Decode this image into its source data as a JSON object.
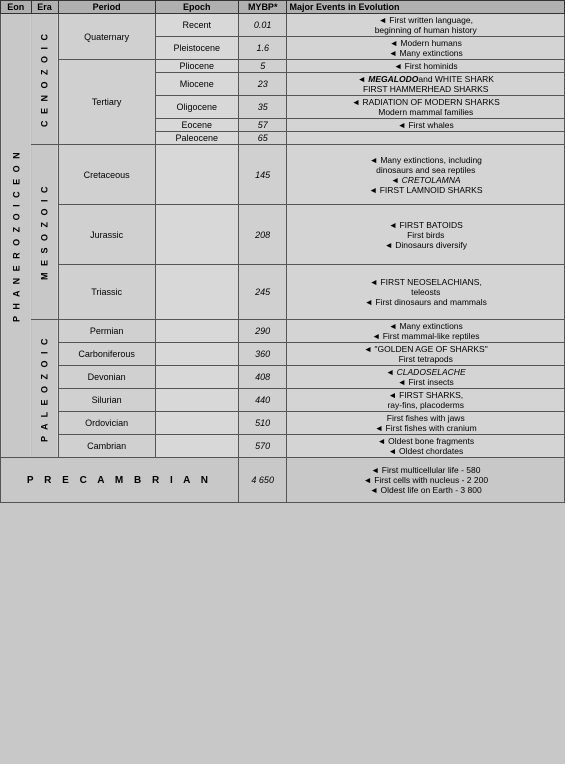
{
  "header": {
    "eon_label": "Eon",
    "era_label": "Era",
    "period_label": "Period",
    "epoch_label": "Epoch",
    "mybp_label": "MYBP*",
    "events_label": "Major Events in Evolution"
  },
  "phanerozoic_eon": "P H A N E R O Z O I C   E O N",
  "cenozoic_era": "C E N O Z O I C",
  "mesozoic_era": "M E S O Z O I C",
  "paleozoic_era": "P A L E O Z O I C",
  "precambrian": "P R E C A M B R I A N",
  "rows": [
    {
      "period": "Quaternary",
      "epoch": "Recent",
      "mybp": "0.01",
      "events": "◄ First written language, beginning of human history"
    },
    {
      "period": "",
      "epoch": "Pleistocene",
      "mybp": "1.6",
      "events": "◄ Modern humans\n◄ Many extinctions"
    },
    {
      "period": "",
      "epoch": "Pliocene",
      "mybp": "5",
      "events": "◄ First hominids"
    },
    {
      "period": "Tertiary",
      "epoch": "Miocene",
      "mybp": "23",
      "events": "◄ MEGALODO and WHITE SHARK\nFIRST HAMMERHEAD SHARKS"
    },
    {
      "period": "",
      "epoch": "Oligocene",
      "mybp": "35",
      "events": "◄ RADIATION OF MODERN SHARKS\nModern mammal families"
    },
    {
      "period": "",
      "epoch": "Eocene",
      "mybp": "57",
      "events": "◄ First whales"
    },
    {
      "period": "",
      "epoch": "Paleocene",
      "mybp": "65",
      "events": ""
    },
    {
      "period": "Cretaceous",
      "epoch": "",
      "mybp": "145",
      "events": "◄ Many extinctions, including dinosaurs and sea reptiles\n◄ CRETOLAMNA\n◄ FIRST LAMNOID SHARKS"
    },
    {
      "period": "Jurassic",
      "epoch": "",
      "mybp": "208",
      "events": "◄ FIRST BATOIDS\nFirst birds\n◄ Dinosaurs diversify"
    },
    {
      "period": "Triassic",
      "epoch": "",
      "mybp": "245",
      "events": "◄ FIRST NEOSELACHIANS, teleosts\n◄ First dinosaurs and mammals"
    },
    {
      "period": "Permian",
      "epoch": "",
      "mybp": "290",
      "events": "◄ Many extinctions\n◄ First mammal-like reptiles"
    },
    {
      "period": "Carboniferous",
      "epoch": "",
      "mybp": "360",
      "events": "◄ \"GOLDEN AGE OF SHARKS\"\nFirst tetrapods"
    },
    {
      "period": "Devonian",
      "epoch": "",
      "mybp": "408",
      "events": "◄ CLADOSELACHE\n◄ First insects"
    },
    {
      "period": "Silurian",
      "epoch": "",
      "mybp": "440",
      "events": "◄ FIRST SHARKS,\nray-fins, placoderms"
    },
    {
      "period": "Ordovician",
      "epoch": "",
      "mybp": "510",
      "events": "First fishes with jaws\n◄ First fishes with cranium"
    },
    {
      "period": "Cambrian",
      "epoch": "",
      "mybp": "570",
      "events": "◄ Oldest bone fragments\n◄ Oldest chordates"
    },
    {
      "period": "PRECAMBRIAN",
      "epoch": "",
      "mybp": "4 650",
      "events": "◄ First multicellular life - 580\n◄ First cells with nucleus - 2 200\n◄ Oldest life on Earth - 3 800"
    }
  ]
}
